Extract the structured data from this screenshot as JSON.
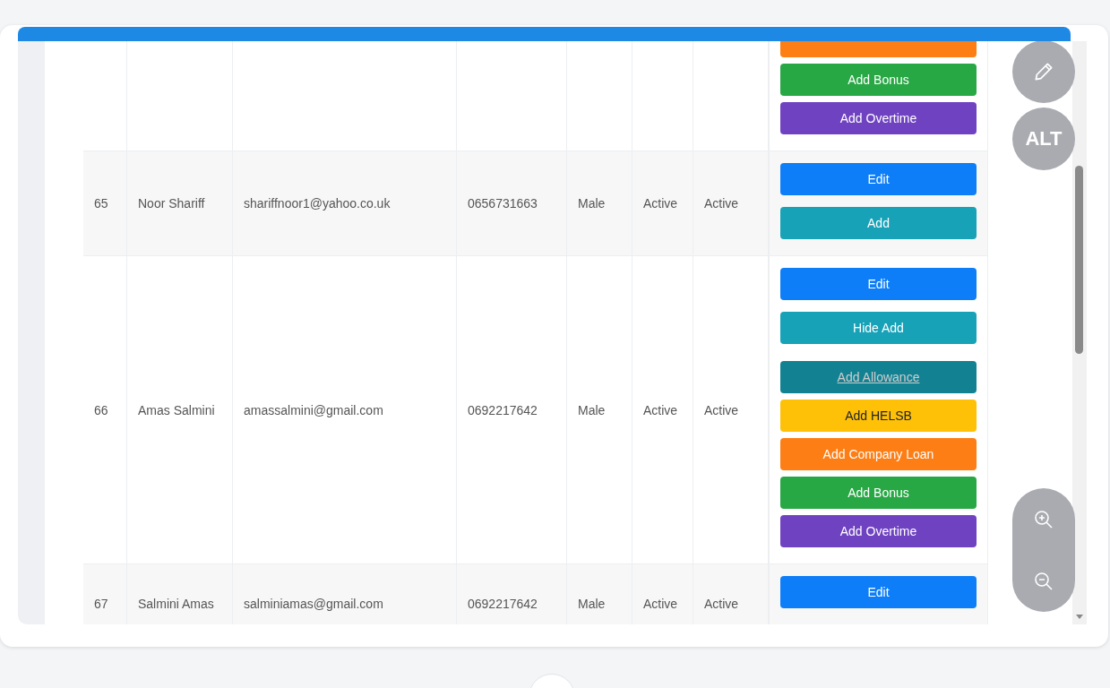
{
  "rows": [
    {
      "actions": [
        {
          "kind": "orange"
        },
        {
          "kind": "success",
          "label": "Add Bonus"
        },
        {
          "kind": "purple",
          "label": "Add Overtime"
        }
      ]
    },
    {
      "id": "65",
      "name": "Noor Shariff",
      "email": "shariffnoor1@yahoo.co.uk",
      "phone": "0656731663",
      "gender": "Male",
      "status": "Active",
      "account": "Active",
      "actions": [
        {
          "kind": "primary",
          "label": "Edit"
        },
        {
          "kind": "info",
          "label": "Add"
        }
      ]
    },
    {
      "id": "66",
      "name": "Amas Salmini",
      "email": "amassalmini@gmail.com",
      "phone": "0692217642",
      "gender": "Male",
      "status": "Active",
      "account": "Active",
      "actions": [
        {
          "kind": "primary",
          "label": "Edit"
        },
        {
          "kind": "info",
          "label": "Hide Add"
        },
        {
          "kind": "info",
          "label": "Add Allowance",
          "hovered": true
        },
        {
          "kind": "warning",
          "label": "Add HELSB"
        },
        {
          "kind": "orange",
          "label": "Add Company Loan"
        },
        {
          "kind": "success",
          "label": "Add Bonus"
        },
        {
          "kind": "purple",
          "label": "Add Overtime"
        }
      ]
    },
    {
      "id": "67",
      "name": "Salmini Amas",
      "email": "salminiamas@gmail.com",
      "phone": "0692217642",
      "gender": "Male",
      "status": "Active",
      "account": "Active",
      "actions": [
        {
          "kind": "primary",
          "label": "Edit"
        }
      ]
    }
  ],
  "tools": [
    {
      "kind": "pencil"
    },
    {
      "kind": "alt",
      "label": "ALT"
    }
  ],
  "zoom": [
    {
      "kind": "in"
    },
    {
      "kind": "out"
    }
  ]
}
